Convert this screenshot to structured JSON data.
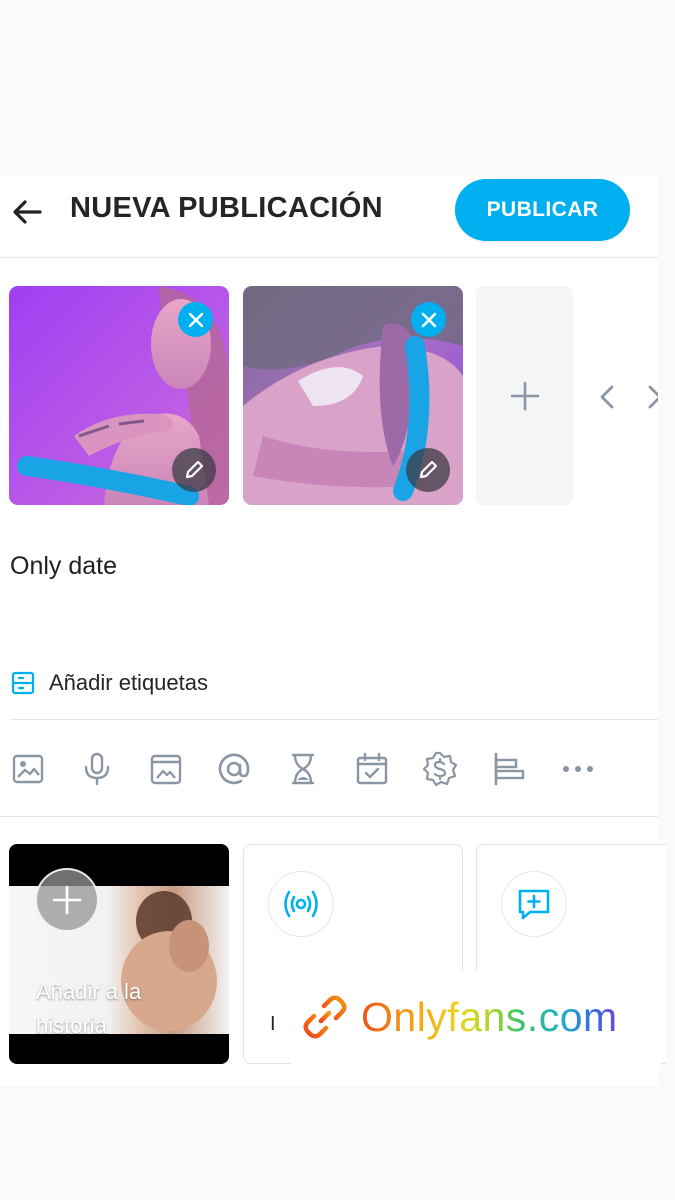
{
  "header": {
    "title": "NUEVA PUBLICACIÓN",
    "publish_label": "PUBLICAR"
  },
  "post": {
    "text": "Only date"
  },
  "tags": {
    "label": "Añadir etiquetas"
  },
  "toolbar": {
    "icons": [
      "image-icon",
      "microphone-icon",
      "vault-icon",
      "mention-icon",
      "hourglass-icon",
      "calendar-icon",
      "price-badge-icon",
      "poll-icon",
      "more-icon"
    ]
  },
  "cards": {
    "story_label": "Añadir a la historia",
    "live_label": "I",
    "qa_label": ""
  },
  "watermark": {
    "text": "Onlyfans.com"
  },
  "colors": {
    "accent": "#00aff0",
    "icon_gray": "#8a96a3",
    "divider": "#e3e5ea"
  }
}
